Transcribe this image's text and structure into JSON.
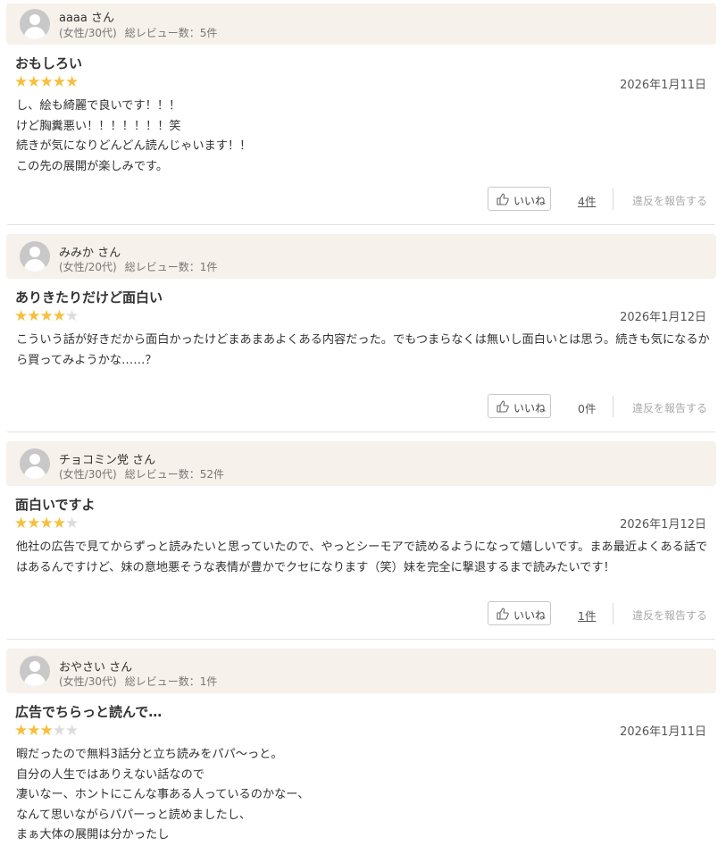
{
  "reviews": [
    {
      "username": "aaaa さん",
      "gender_age": "(女性/30代)",
      "review_count": "総レビュー数：5件",
      "title": "おもしろい",
      "rating": 5,
      "date": "2026年1月11日",
      "body": "し、絵も綺麗で良いです！！！\nけど胸糞悪い！！！！！！！笑\n続きが気になりどんどん読んじゃいます！！\nこの先の展開が楽しみです。",
      "like_label": "いいね",
      "like_count": "4件",
      "report_label": "違反を報告する"
    },
    {
      "username": "みみか さん",
      "gender_age": "(女性/20代)",
      "review_count": "総レビュー数：1件",
      "title": "ありきたりだけど面白い",
      "rating": 4,
      "date": "2026年1月12日",
      "body": "こういう話が好きだから面白かったけどまあまあよくある内容だった。でもつまらなくは無いし面白いとは思う。続きも気になるから買ってみようかな……？",
      "like_label": "いいね",
      "like_count": "0件",
      "report_label": "違反を報告する"
    },
    {
      "username": "チョコミン党 さん",
      "gender_age": "(女性/30代)",
      "review_count": "総レビュー数：52件",
      "title": "面白いですよ",
      "rating": 4,
      "date": "2026年1月12日",
      "body": "他社の広告で見てからずっと読みたいと思っていたので、やっとシーモアで読めるようになって嬉しいです。まあ最近よくある話ではあるんですけど、妹の意地悪そうな表情が豊かでクセになります（笑）妹を完全に撃退するまで読みたいです！",
      "like_label": "いいね",
      "like_count": "1件",
      "report_label": "違反を報告する"
    },
    {
      "username": "おやさい さん",
      "gender_age": "(女性/30代)",
      "review_count": "総レビュー数：1件",
      "title": "広告でちらっと読んで…",
      "rating": 3,
      "date": "2026年1月11日",
      "body": "暇だったので無料3話分と立ち読みをパパ〜っと。\n自分の人生ではありえない話なので\n凄いなー、ホントにこんな事ある人っているのかなー、\nなんて思いながらパパーっと読めましたし、\nまぁ大体の展開は分かったし"
    }
  ],
  "colors": {
    "header_bg": "#f6f1ea",
    "star_on": "#f6bf3c",
    "star_off": "#dcdcdc",
    "report_text": "#aaaaaa"
  }
}
